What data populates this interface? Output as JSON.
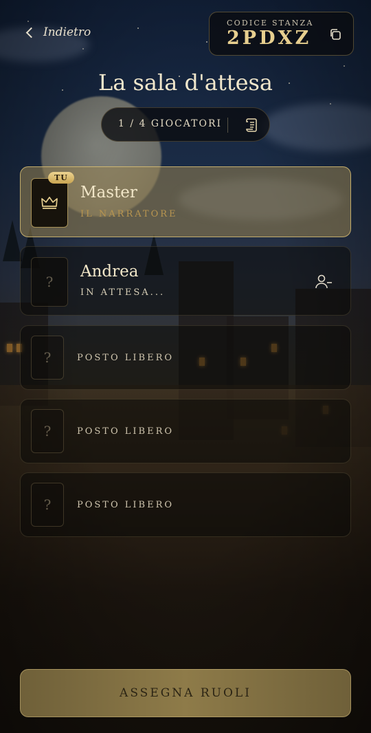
{
  "header": {
    "back_label": "Indietro",
    "room_code_label": "CODICE STANZA",
    "room_code": "2PDXZ"
  },
  "title": "La sala d'attesa",
  "counter": {
    "text": "1 / 4 GIOCATORI"
  },
  "players": [
    {
      "name": "Master",
      "subtitle": "IL NARRATORE",
      "badge": "TU",
      "icon": "crown-icon"
    },
    {
      "name": "Andrea",
      "subtitle": "IN ATTESA...",
      "placeholder": "?",
      "icon": "remove-user-icon"
    }
  ],
  "free_slots": [
    {
      "placeholder": "?",
      "label": "POSTO LIBERO"
    },
    {
      "placeholder": "?",
      "label": "POSTO LIBERO"
    },
    {
      "placeholder": "?",
      "label": "POSTO LIBERO"
    }
  ],
  "assign_button": "ASSEGNA RUOLI",
  "colors": {
    "gold": "#e7cf8f",
    "muted_gold": "#b89550",
    "panel_dark": "#0a0c10",
    "button": "#8e7b49"
  }
}
